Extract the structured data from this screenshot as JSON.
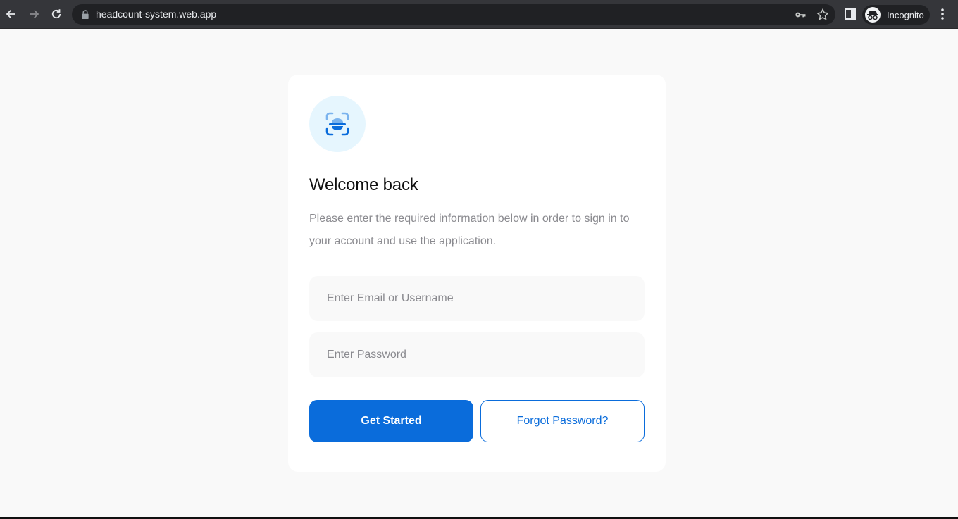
{
  "browser": {
    "url": "headcount-system.web.app",
    "profile_label": "Incognito",
    "icons": {
      "back": "arrow-left-icon",
      "forward": "arrow-right-icon",
      "reload": "reload-icon",
      "lock": "lock-icon",
      "key": "key-icon",
      "bookmark": "star-icon",
      "side_panel": "side-panel-icon",
      "incognito": "incognito-icon",
      "menu": "kebab-menu-icon"
    }
  },
  "login": {
    "logo_icon": "face-scan-icon",
    "title": "Welcome back",
    "subtitle": "Please enter the required information below in order to sign in to your account and use the application.",
    "email_placeholder": "Enter Email or Username",
    "email_value": "",
    "password_placeholder": "Enter Password",
    "password_value": "",
    "primary_button": "Get Started",
    "secondary_button": "Forgot Password?"
  },
  "colors": {
    "accent": "#0a6cdb",
    "logo_bg": "#e6f6fe",
    "page_bg": "#f9f9f9"
  }
}
